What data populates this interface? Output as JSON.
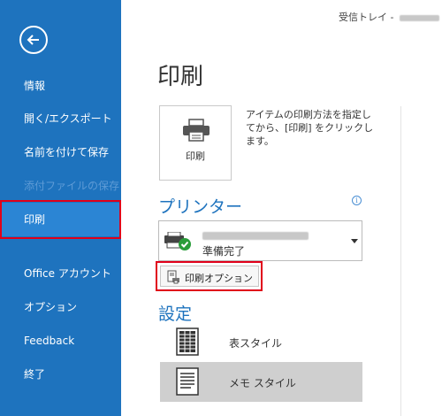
{
  "window": {
    "title": "受信トレイ -"
  },
  "sidebar": {
    "items": [
      {
        "label": "情報"
      },
      {
        "label": "開く/エクスポート"
      },
      {
        "label": "名前を付けて保存"
      },
      {
        "label": "添付ファイルの保存"
      },
      {
        "label": "印刷"
      },
      {
        "label": "Office アカウント"
      },
      {
        "label": "オプション"
      },
      {
        "label": "Feedback"
      },
      {
        "label": "終了"
      }
    ]
  },
  "main": {
    "title": "印刷",
    "print_button": {
      "label": "印刷"
    },
    "description": "アイテムの印刷方法を指定してから、[印刷] をクリックします。",
    "printer": {
      "heading": "プリンター",
      "info_icon": "i",
      "status": "準備完了"
    },
    "print_options": {
      "label": "印刷オプション"
    },
    "settings": {
      "heading": "設定",
      "styles": [
        {
          "label": "表スタイル"
        },
        {
          "label": "メモ スタイル"
        }
      ]
    }
  },
  "colors": {
    "sidebar": "#1e73be",
    "highlight": "#e0001a",
    "heading": "#1e73be"
  }
}
